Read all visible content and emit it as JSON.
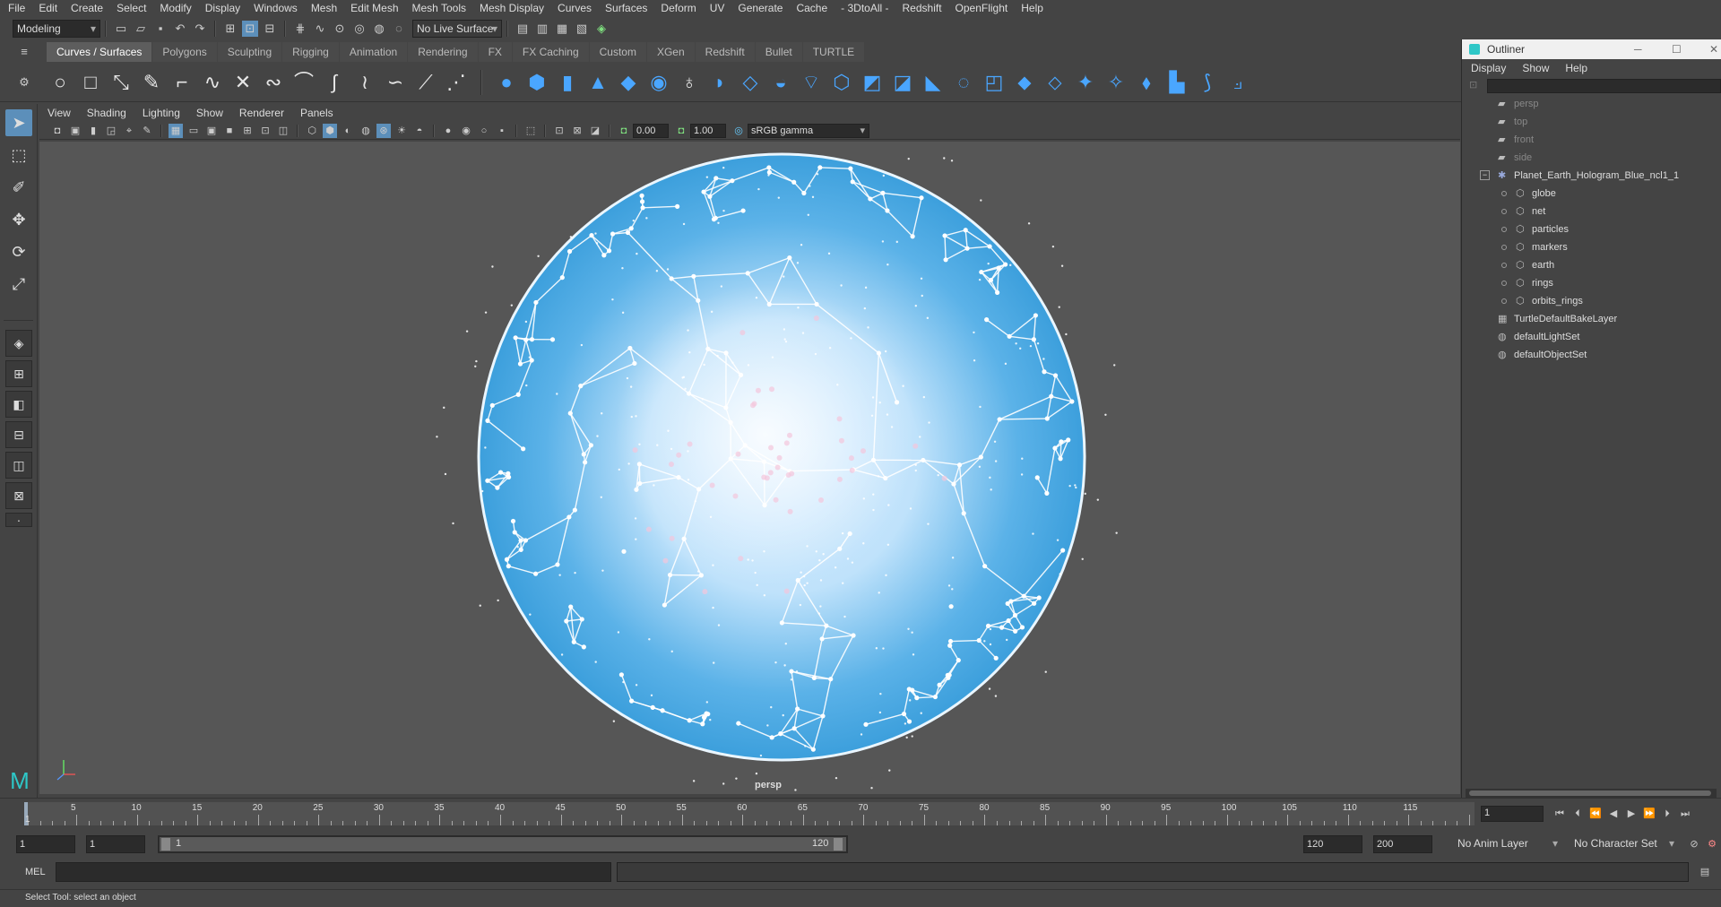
{
  "menubar": [
    "File",
    "Edit",
    "Create",
    "Select",
    "Modify",
    "Display",
    "Windows",
    "Mesh",
    "Edit Mesh",
    "Mesh Tools",
    "Mesh Display",
    "Curves",
    "Surfaces",
    "Deform",
    "UV",
    "Generate",
    "Cache",
    "- 3DtoAll -",
    "Redshift",
    "OpenFlight",
    "Help"
  ],
  "status": {
    "mode": "Modeling",
    "live_surface": "No Live Surface"
  },
  "shelf_tabs": [
    "Curves / Surfaces",
    "Polygons",
    "Sculpting",
    "Rigging",
    "Animation",
    "Rendering",
    "FX",
    "FX Caching",
    "Custom",
    "XGen",
    "Redshift",
    "Bullet",
    "TURTLE"
  ],
  "shelf_active": 0,
  "viewport": {
    "menu": [
      "View",
      "Shading",
      "Lighting",
      "Show",
      "Renderer",
      "Panels"
    ],
    "exposure": "0.00",
    "gamma": "1.00",
    "colorspace": "sRGB gamma",
    "camera_label": "persp"
  },
  "outliner": {
    "title": "Outliner",
    "menu": [
      "Display",
      "Show",
      "Help"
    ],
    "items": [
      {
        "label": "persp",
        "dim": true,
        "indent": 0,
        "icon": "camera-icon"
      },
      {
        "label": "top",
        "dim": true,
        "indent": 0,
        "icon": "camera-icon"
      },
      {
        "label": "front",
        "dim": true,
        "indent": 0,
        "icon": "camera-icon"
      },
      {
        "label": "side",
        "dim": true,
        "indent": 0,
        "icon": "camera-icon"
      },
      {
        "label": "Planet_Earth_Hologram_Blue_ncl1_1",
        "dim": false,
        "indent": 0,
        "icon": "group-icon",
        "expander": true
      },
      {
        "label": "globe",
        "dim": false,
        "indent": 1,
        "icon": "mesh-icon"
      },
      {
        "label": "net",
        "dim": false,
        "indent": 1,
        "icon": "mesh-icon"
      },
      {
        "label": "particles",
        "dim": false,
        "indent": 1,
        "icon": "mesh-icon"
      },
      {
        "label": "markers",
        "dim": false,
        "indent": 1,
        "icon": "mesh-icon"
      },
      {
        "label": "earth",
        "dim": false,
        "indent": 1,
        "icon": "mesh-icon"
      },
      {
        "label": "rings",
        "dim": false,
        "indent": 1,
        "icon": "mesh-icon"
      },
      {
        "label": "orbits_rings",
        "dim": false,
        "indent": 1,
        "icon": "mesh-icon"
      },
      {
        "label": "TurtleDefaultBakeLayer",
        "dim": false,
        "indent": 0,
        "icon": "layer-icon"
      },
      {
        "label": "defaultLightSet",
        "dim": false,
        "indent": 0,
        "icon": "set-icon"
      },
      {
        "label": "defaultObjectSet",
        "dim": false,
        "indent": 0,
        "icon": "set-icon"
      }
    ]
  },
  "timeline": {
    "ticks": [
      "5",
      "10",
      "15",
      "20",
      "25",
      "30",
      "35",
      "40",
      "45",
      "50",
      "55",
      "60",
      "65",
      "70",
      "75",
      "80",
      "85",
      "90",
      "95",
      "100",
      "105",
      "110",
      "115"
    ],
    "first_label": "1",
    "current_frame": "1"
  },
  "range": {
    "start": "1",
    "playback_start": "1",
    "slider_start": "1",
    "slider_end": "120",
    "playback_end": "120",
    "end": "200",
    "anim_layer": "No Anim Layer",
    "character_set": "No Character Set"
  },
  "command": {
    "label": "MEL"
  },
  "help_text": "Select Tool: select an object"
}
